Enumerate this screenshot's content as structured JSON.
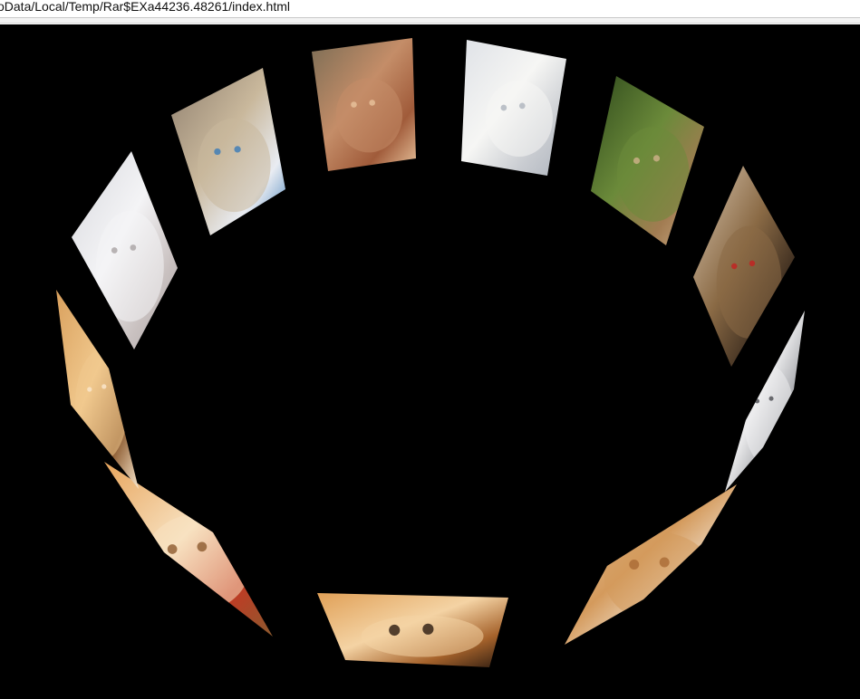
{
  "address_bar": {
    "url_text": "oData/Local/Temp/Rar$EXa44236.48261/index.html"
  },
  "colors": {
    "page_background": "#000000",
    "chrome_background": "#ffffff",
    "address_text": "#111111"
  },
  "carousel": {
    "photos": [
      {
        "name": "white-kitten-photo",
        "subject": "white kitten",
        "palette": [
          "#d7d8dd",
          "#f4f4f6",
          "#c9c1c0",
          "#a9a3a4"
        ]
      },
      {
        "name": "blue-eyed-kitten-photo",
        "subject": "blue-eyed tabby kitten",
        "palette": [
          "#8f7f6e",
          "#c9b89c",
          "#e9ecf2",
          "#3a7ab8"
        ]
      },
      {
        "name": "kitten-in-basket-photo",
        "subject": "kitten in basket",
        "palette": [
          "#7b6d55",
          "#c48d68",
          "#a05b3a",
          "#e8c39c"
        ]
      },
      {
        "name": "polar-bear-photo",
        "subject": "polar bear",
        "palette": [
          "#dfe2e7",
          "#f6f6f4",
          "#c9ccd1",
          "#aeb4bd"
        ]
      },
      {
        "name": "chipmunk-photo",
        "subject": "chipmunk",
        "palette": [
          "#2f4a1c",
          "#6b8a3a",
          "#a27c52",
          "#d0b18b"
        ]
      },
      {
        "name": "yorkie-puppy-photo",
        "subject": "yorkie puppy",
        "palette": [
          "#d9c6b0",
          "#8a6a45",
          "#3e2e20",
          "#c42020"
        ]
      },
      {
        "name": "husky-puppy-photo",
        "subject": "husky puppy",
        "palette": [
          "#1f1f22",
          "#ededee",
          "#8a8c92",
          "#4a4b50"
        ]
      },
      {
        "name": "golden-puppy-photo",
        "subject": "golden puppy",
        "palette": [
          "#f0ddc4",
          "#d49a5c",
          "#f7f2ea",
          "#a96a35"
        ]
      },
      {
        "name": "pomeranian-photo",
        "subject": "pomeranian",
        "palette": [
          "#e0a057",
          "#f4d3a4",
          "#a5622b",
          "#2a1a10"
        ]
      },
      {
        "name": "puppy-red-collar-photo",
        "subject": "puppy with red collar",
        "palette": [
          "#e7a55d",
          "#f8e2c1",
          "#c23a24",
          "#8c5a2e"
        ]
      },
      {
        "name": "fluffy-puppy-photo",
        "subject": "fluffy puppy",
        "palette": [
          "#d9a05d",
          "#f1c98e",
          "#8c5b30",
          "#fbe9cf"
        ]
      }
    ]
  }
}
